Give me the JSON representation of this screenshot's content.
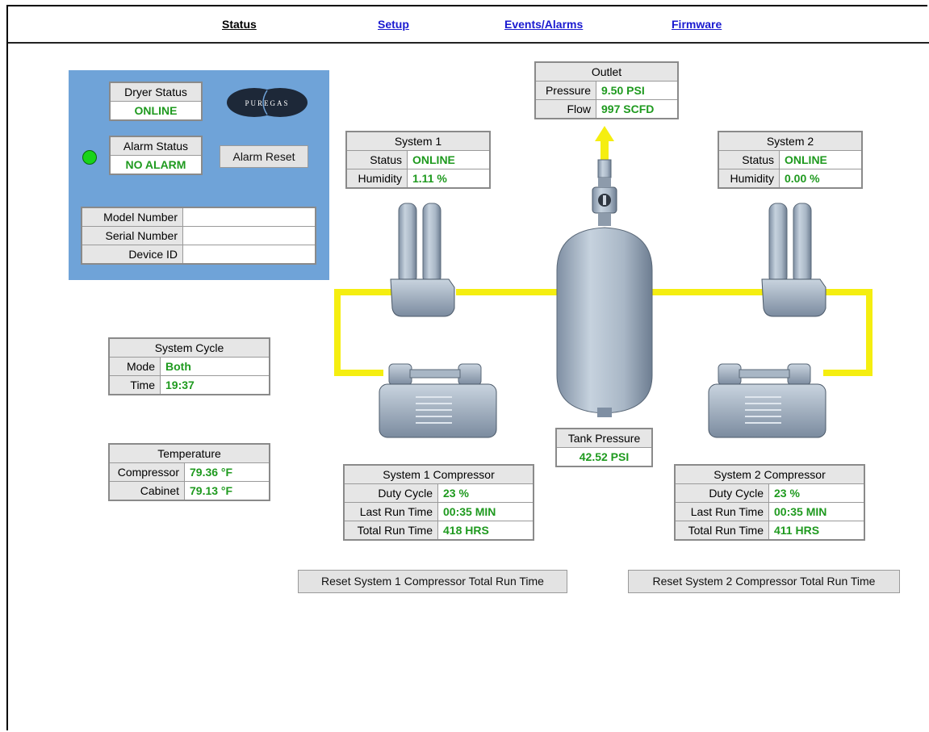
{
  "nav": {
    "status": "Status",
    "setup": "Setup",
    "events": "Events/Alarms",
    "firmware": "Firmware"
  },
  "brand": {
    "logo_text": "PUREGAS"
  },
  "dryer": {
    "status_label": "Dryer Status",
    "status_value": "ONLINE",
    "alarm_label": "Alarm Status",
    "alarm_value": "NO ALARM",
    "alarm_reset": "Alarm Reset",
    "led_color": "#19d419"
  },
  "device": {
    "model_label": "Model Number",
    "model_value": "",
    "serial_label": "Serial Number",
    "serial_value": "",
    "device_label": "Device ID",
    "device_value": ""
  },
  "cycle": {
    "title": "System Cycle",
    "mode_label": "Mode",
    "mode_value": "Both",
    "time_label": "Time",
    "time_value": "19:37"
  },
  "temperature": {
    "title": "Temperature",
    "compressor_label": "Compressor",
    "compressor_value": "79.36 °F",
    "cabinet_label": "Cabinet",
    "cabinet_value": "79.13 °F"
  },
  "outlet": {
    "title": "Outlet",
    "pressure_label": "Pressure",
    "pressure_value": "9.50 PSI",
    "flow_label": "Flow",
    "flow_value": "997 SCFD"
  },
  "system1": {
    "title": "System 1",
    "status_label": "Status",
    "status_value": "ONLINE",
    "humidity_label": "Humidity",
    "humidity_value": "1.11 %"
  },
  "system2": {
    "title": "System 2",
    "status_label": "Status",
    "status_value": "ONLINE",
    "humidity_label": "Humidity",
    "humidity_value": "0.00 %"
  },
  "tank": {
    "title": "Tank Pressure",
    "value": "42.52 PSI"
  },
  "comp1": {
    "title": "System 1 Compressor",
    "duty_label": "Duty Cycle",
    "duty_value": "23 %",
    "last_label": "Last Run Time",
    "last_value": "00:35 MIN",
    "total_label": "Total Run Time",
    "total_value": "418 HRS",
    "reset": "Reset System 1 Compressor Total Run Time"
  },
  "comp2": {
    "title": "System 2 Compressor",
    "duty_label": "Duty Cycle",
    "duty_value": "23 %",
    "last_label": "Last Run Time",
    "last_value": "00:35 MIN",
    "total_label": "Total Run Time",
    "total_value": "411 HRS",
    "reset": "Reset System 2 Compressor Total Run Time"
  },
  "colors": {
    "pipe": "#f5ee10",
    "panel": "#6fa3d8",
    "value_green": "#1f9a1f",
    "link": "#1a1ad0"
  }
}
